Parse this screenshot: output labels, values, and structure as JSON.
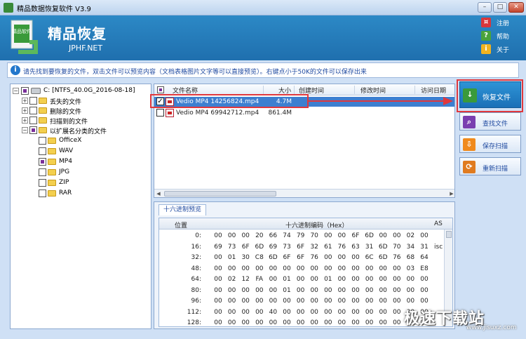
{
  "window": {
    "title": "精品数据恢复软件 V3.9",
    "buttons": {
      "minimize": "–",
      "restore": "□",
      "close": "✕"
    }
  },
  "banner": {
    "logo_text": "精品软件",
    "title": "精品恢复",
    "subtitle": "JPHF.NET",
    "links": [
      {
        "label": "注册",
        "icon": "cart-icon",
        "color": "#d8363a"
      },
      {
        "label": "帮助",
        "icon": "question-icon",
        "color": "#4aa33b"
      },
      {
        "label": "关于",
        "icon": "info-icon",
        "color": "#f0b31f"
      }
    ]
  },
  "info": {
    "text": "请先找到要恢复的文件，双击文件可以预览内容（文档表格图片文字等可以直接预览）。右键点小于50K的文件可以保存出来"
  },
  "tree": {
    "root": "C:  [NTFS_40.0G_2016-08-18]",
    "items": [
      "丢失的文件",
      "删除的文件",
      "扫描到的文件",
      "以扩展名分类的文件"
    ],
    "ext_items": [
      "OfficeX",
      "WAV",
      "MP4",
      "JPG",
      "ZIP",
      "RAR"
    ]
  },
  "files": {
    "columns": [
      "文件名称",
      "大小",
      "创建时间",
      "修改时间",
      "访问日期"
    ],
    "rows": [
      {
        "name": "Vedio MP4 14256824.mp4",
        "size": "4.7M",
        "checked": true
      },
      {
        "name": "Vedio MP4 69942712.mp4",
        "size": "861.4M",
        "checked": false
      }
    ]
  },
  "hex": {
    "tab": "十六进制预览",
    "col_offset": "位置",
    "col_hex": "十六进制编码（Hex）",
    "col_ascii": "AS",
    "rows": [
      {
        "offset": "0:",
        "bytes": [
          "00",
          "00",
          "00",
          "20",
          "66",
          "74",
          "79",
          "70",
          "00",
          "00",
          "6F",
          "6D",
          "00",
          "00",
          "02",
          "00"
        ],
        "ascii": ""
      },
      {
        "offset": "16:",
        "bytes": [
          "69",
          "73",
          "6F",
          "6D",
          "69",
          "73",
          "6F",
          "32",
          "61",
          "76",
          "63",
          "31",
          "6D",
          "70",
          "34",
          "31"
        ],
        "ascii": "isc"
      },
      {
        "offset": "32:",
        "bytes": [
          "00",
          "01",
          "30",
          "C8",
          "6D",
          "6F",
          "6F",
          "76",
          "00",
          "00",
          "00",
          "6C",
          "6D",
          "76",
          "68",
          "64"
        ],
        "ascii": ""
      },
      {
        "offset": "48:",
        "bytes": [
          "00",
          "00",
          "00",
          "00",
          "00",
          "00",
          "00",
          "00",
          "00",
          "00",
          "00",
          "00",
          "00",
          "00",
          "03",
          "E8"
        ],
        "ascii": ""
      },
      {
        "offset": "64:",
        "bytes": [
          "00",
          "02",
          "12",
          "FA",
          "00",
          "01",
          "00",
          "00",
          "01",
          "00",
          "00",
          "00",
          "00",
          "00",
          "00",
          "00"
        ],
        "ascii": ""
      },
      {
        "offset": "80:",
        "bytes": [
          "00",
          "00",
          "00",
          "00",
          "00",
          "01",
          "00",
          "00",
          "00",
          "00",
          "00",
          "00",
          "00",
          "00",
          "00",
          "00"
        ],
        "ascii": ""
      },
      {
        "offset": "96:",
        "bytes": [
          "00",
          "00",
          "00",
          "00",
          "00",
          "00",
          "00",
          "00",
          "00",
          "00",
          "00",
          "00",
          "00",
          "00",
          "00",
          "00"
        ],
        "ascii": ""
      },
      {
        "offset": "112:",
        "bytes": [
          "00",
          "00",
          "00",
          "00",
          "40",
          "00",
          "00",
          "00",
          "00",
          "00",
          "00",
          "00",
          "00",
          "00",
          "00",
          "00"
        ],
        "ascii": ""
      },
      {
        "offset": "128:",
        "bytes": [
          "00",
          "00",
          "00",
          "00",
          "00",
          "00",
          "00",
          "00",
          "00",
          "00",
          "00",
          "00",
          "00",
          "00",
          "00",
          "00"
        ],
        "ascii": ""
      }
    ]
  },
  "actions": [
    {
      "label": "恢复文件",
      "icon": "recover-icon",
      "color": "#3a9a3a"
    },
    {
      "label": "查找文件",
      "icon": "search-icon",
      "color": "#7a3fb0"
    },
    {
      "label": "保存扫描",
      "icon": "save-icon",
      "color": "#f08a1c"
    },
    {
      "label": "重新扫描",
      "icon": "rescan-icon",
      "color": "#e07b1f"
    }
  ],
  "watermark": {
    "text": "极速下载站",
    "sub": "www.jisuxz.com"
  }
}
